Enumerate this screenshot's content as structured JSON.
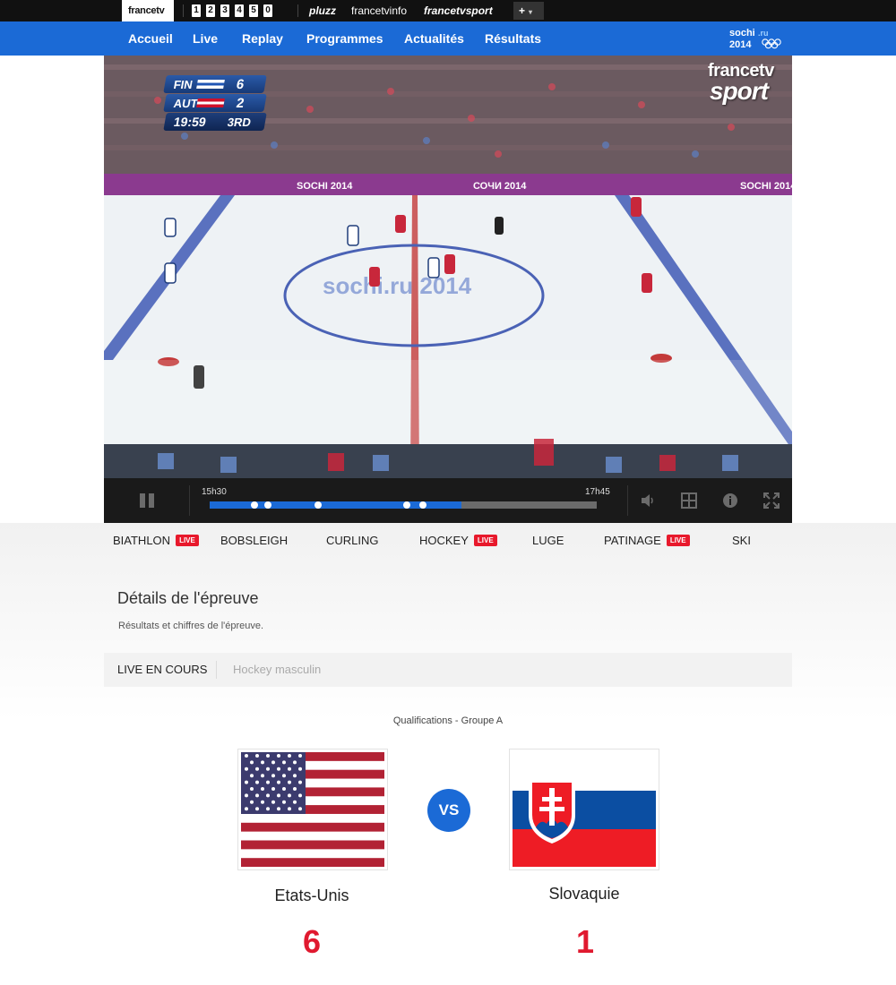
{
  "topbar": {
    "brand": "francetv",
    "channels": [
      "1",
      "2",
      "3",
      "4",
      "5",
      "0"
    ],
    "links": [
      "pluzz",
      "francetvinfo",
      "francetvsport"
    ],
    "more_label": "+"
  },
  "nav": {
    "items": [
      "Accueil",
      "Live",
      "Replay",
      "Programmes",
      "Actualités",
      "Résultats"
    ],
    "logo_text": "sochi.ru 2014"
  },
  "video": {
    "scorebug": {
      "team1": "FIN",
      "score1": "6",
      "team2": "AUT",
      "score2": "2",
      "clock": "19:59",
      "period": "3RD"
    },
    "watermark_top": "francetv",
    "watermark_bottom": "sport",
    "board_text": "SOCHI 2014",
    "board_text_ru": "СОЧИ 2014"
  },
  "player": {
    "start_time": "15h30",
    "end_time": "17h45",
    "progress_fraction": 0.65,
    "markers": [
      0.115,
      0.151,
      0.281,
      0.509,
      0.551
    ]
  },
  "sports": [
    {
      "name": "BIATHLON",
      "live": true
    },
    {
      "name": "BOBSLEIGH",
      "live": false
    },
    {
      "name": "CURLING",
      "live": false
    },
    {
      "name": "HOCKEY",
      "live": true
    },
    {
      "name": "LUGE",
      "live": false
    },
    {
      "name": "PATINAGE",
      "live": true
    },
    {
      "name": "SKI",
      "live": false
    }
  ],
  "live_badge": "LIVE",
  "details": {
    "title": "Détails de l'épreuve",
    "subtitle": "Résultats et chiffres de l'épreuve.",
    "live_label": "LIVE EN COURS",
    "event": "Hockey masculin",
    "phase": "Qualifications - Groupe A"
  },
  "match": {
    "vs": "VS",
    "home": {
      "name": "Etats-Unis",
      "score": "6"
    },
    "away": {
      "name": "Slovaquie",
      "score": "1"
    }
  },
  "colors": {
    "nav_blue": "#1b6ad6",
    "live_red": "#e8192c",
    "score_red": "#e0192f"
  }
}
